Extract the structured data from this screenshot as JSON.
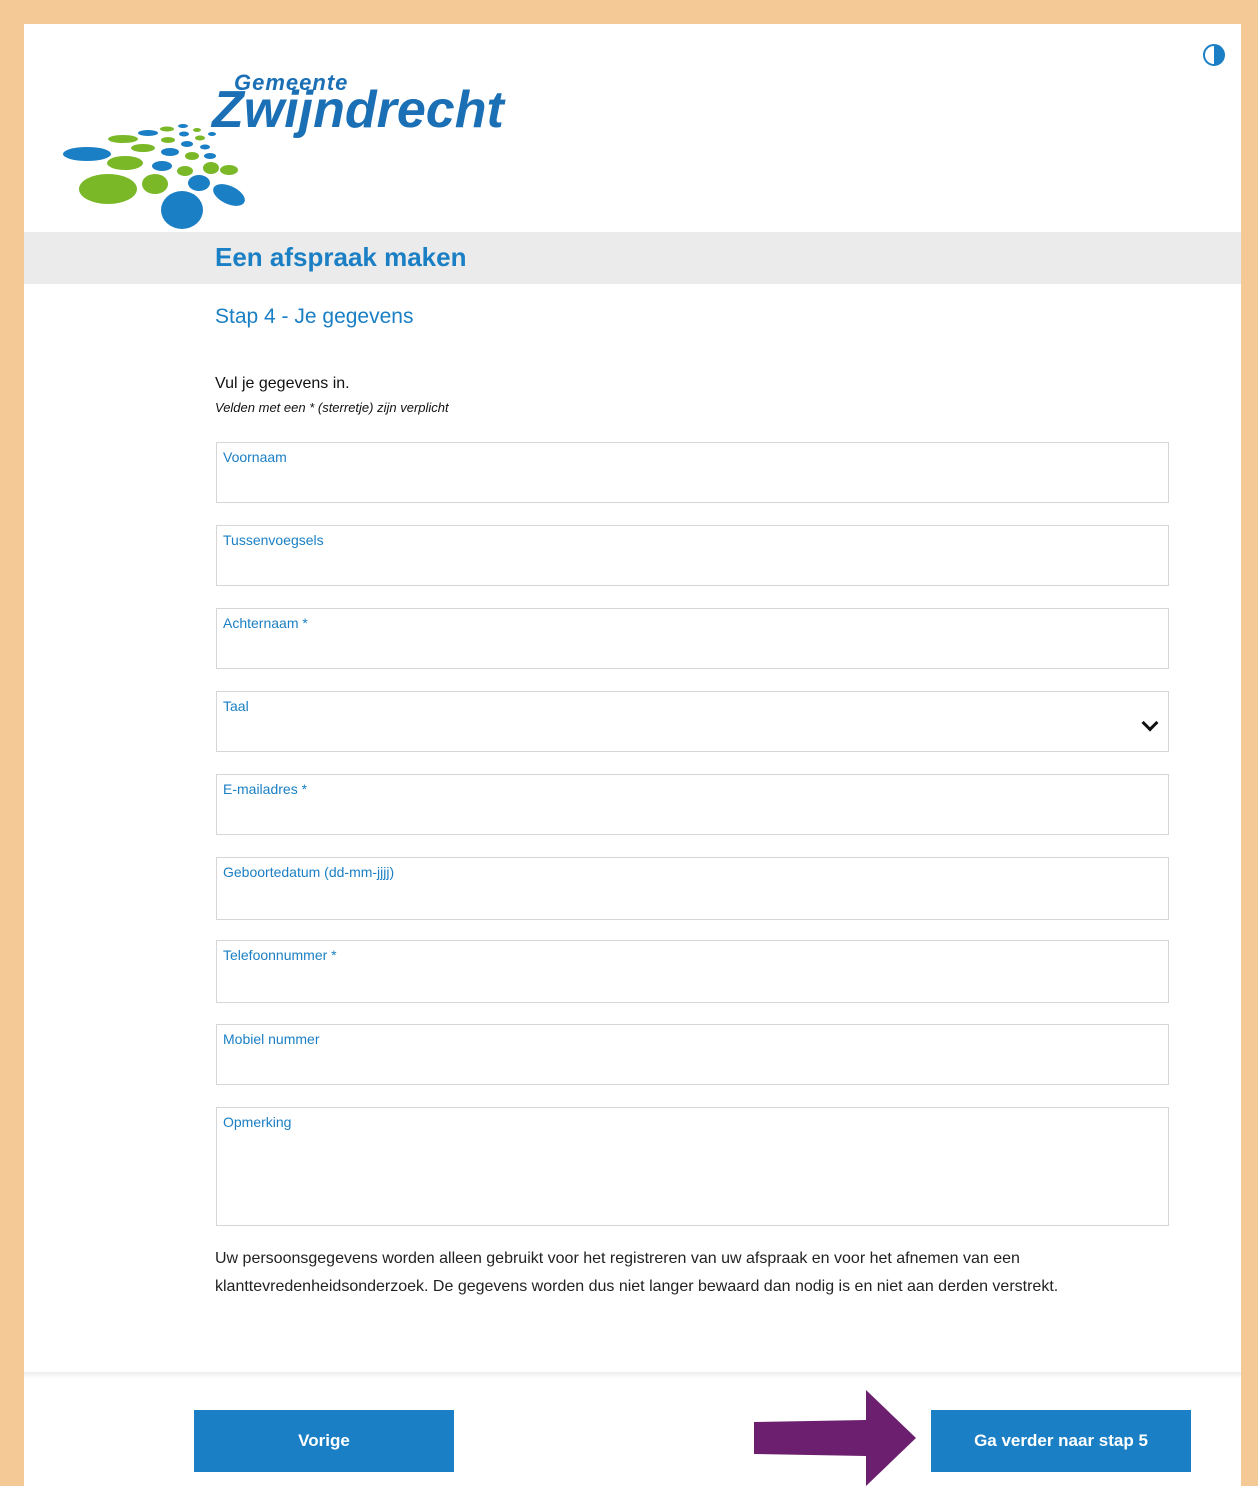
{
  "brand": {
    "small_text": "Gemeente",
    "name": "Zwijndrecht",
    "colors": {
      "blue": "#1a7fc4",
      "green": "#7ab828",
      "frame": "#f5c995"
    }
  },
  "header": {
    "contrast_icon": "contrast-icon"
  },
  "page": {
    "title": "Een afspraak maken",
    "step": "Stap 4 - Je gegevens",
    "intro": "Vul je gegevens in.",
    "required_note": "Velden met een * (sterretje) zijn verplicht"
  },
  "form": {
    "fields": [
      {
        "label": "Voornaam",
        "value": ""
      },
      {
        "label": "Tussenvoegsels",
        "value": ""
      },
      {
        "label": "Achternaam *",
        "value": ""
      },
      {
        "label": "Taal",
        "value": "",
        "type": "select"
      },
      {
        "label": "E-mailadres *",
        "value": ""
      },
      {
        "label": "Geboortedatum (dd-mm-jjjj)",
        "value": ""
      },
      {
        "label": "Telefoonnummer *",
        "value": ""
      },
      {
        "label": "Mobiel nummer",
        "value": ""
      },
      {
        "label": "Opmerking",
        "value": "",
        "type": "textarea"
      }
    ]
  },
  "privacy_text": "Uw persoonsgegevens worden alleen gebruikt voor het registreren van uw afspraak en voor het afnemen van een klanttevredenheidsonderzoek. De gegevens worden dus niet langer bewaard dan nodig is en niet aan derden verstrekt.",
  "footer": {
    "prev_label": "Vorige",
    "next_label": "Ga verder naar stap 5",
    "annotation_color": "#6b1f6e"
  }
}
